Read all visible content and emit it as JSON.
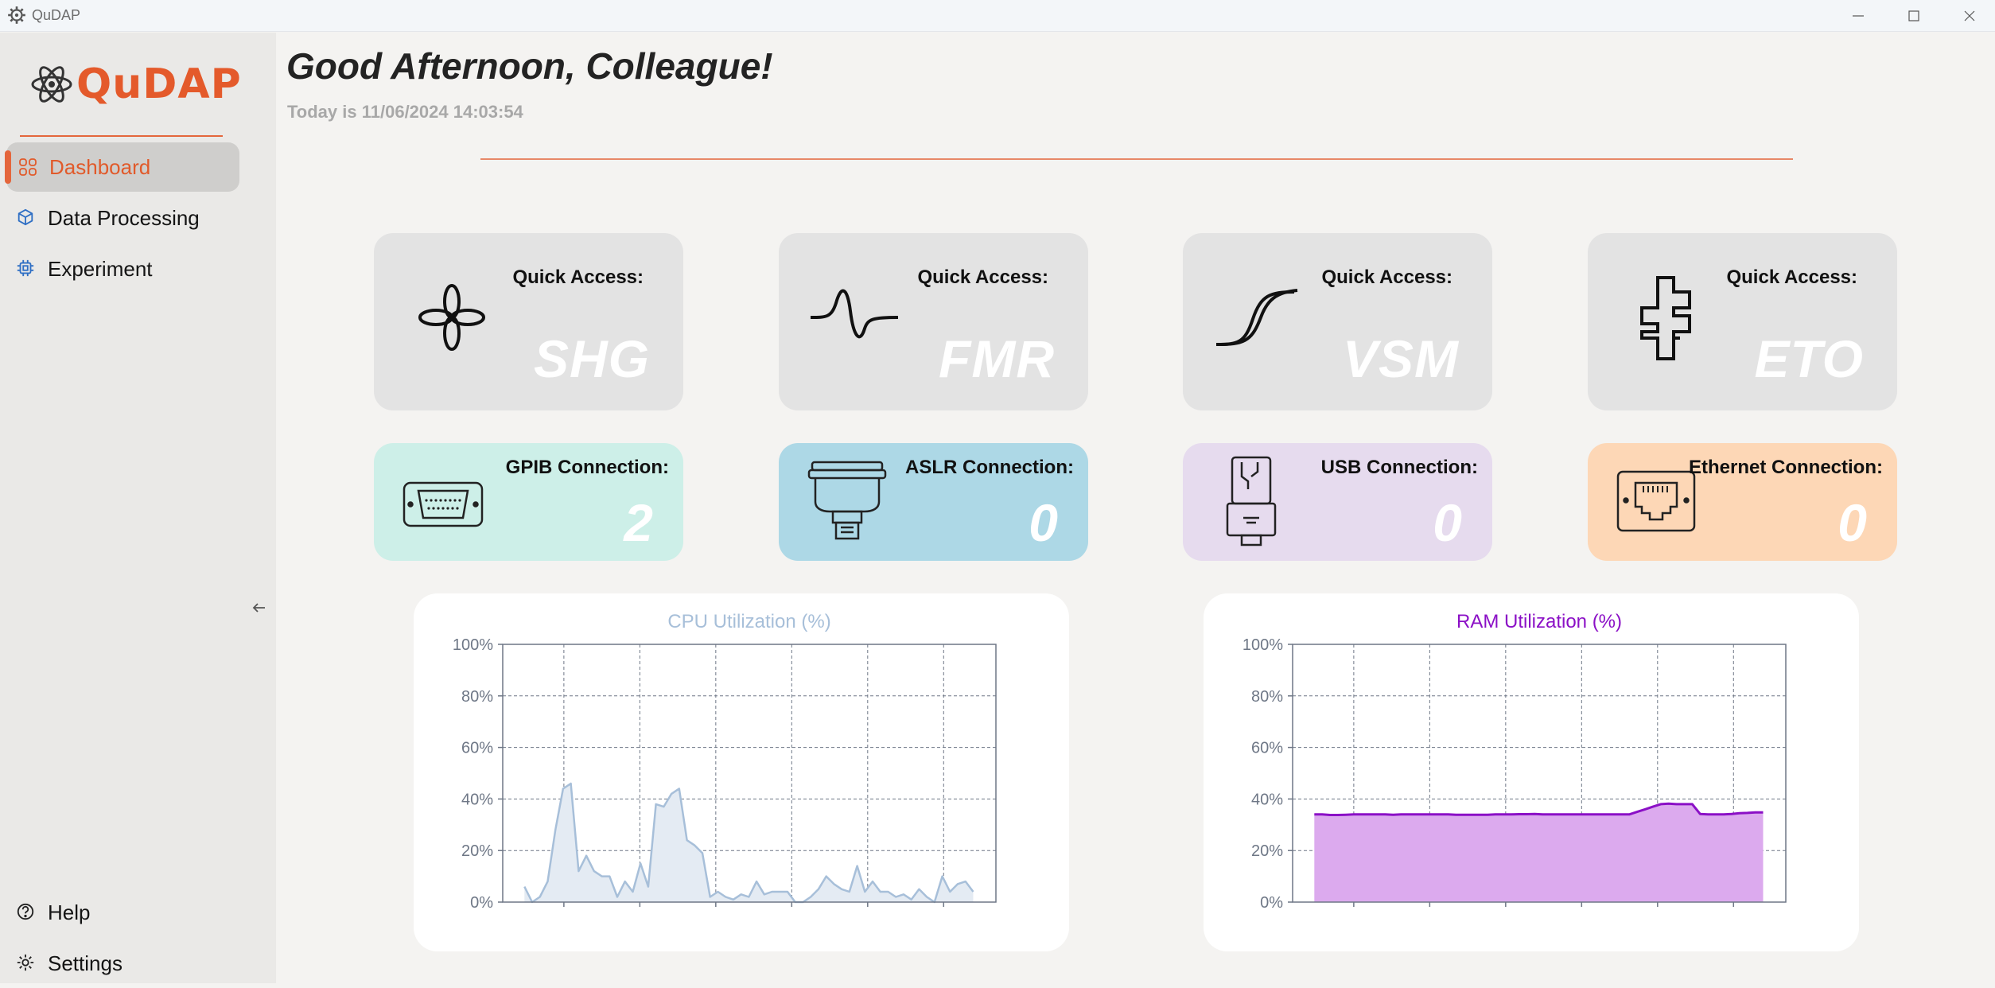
{
  "window": {
    "title": "QuDAP"
  },
  "sidebar": {
    "logo_text": "QuDAP",
    "items": [
      {
        "label": "Dashboard",
        "icon": "grid-icon",
        "active": true
      },
      {
        "label": "Data Processing",
        "icon": "cube-icon",
        "active": false
      },
      {
        "label": "Experiment",
        "icon": "chip-icon",
        "active": false
      }
    ],
    "bottom_items": [
      {
        "label": "Help",
        "icon": "help-icon"
      },
      {
        "label": "Settings",
        "icon": "gear-icon"
      }
    ]
  },
  "header": {
    "greeting": "Good Afternoon, Colleague!",
    "date": "Today is 11/06/2024 14:03:54"
  },
  "quick_access": [
    {
      "label": "Quick Access:",
      "value": "SHG",
      "icon": "flower-icon"
    },
    {
      "label": "Quick Access:",
      "value": "FMR",
      "icon": "resonance-icon"
    },
    {
      "label": "Quick Access:",
      "value": "VSM",
      "icon": "hysteresis-icon"
    },
    {
      "label": "Quick Access:",
      "value": "ETO",
      "icon": "hall-bar-icon"
    }
  ],
  "connections": [
    {
      "label": "GPIB Connection:",
      "value": "2",
      "icon": "gpib-port-icon",
      "color": "#cdefe8"
    },
    {
      "label": "ASLR Connection:",
      "value": "0",
      "icon": "serial-port-icon",
      "color": "#add8e6"
    },
    {
      "label": "USB Connection:",
      "value": "0",
      "icon": "usb-icon",
      "color": "#e6dbee"
    },
    {
      "label": "Ethernet Connection:",
      "value": "0",
      "icon": "ethernet-icon",
      "color": "#fdd7b6"
    }
  ],
  "colors": {
    "accent": "#e45a2b",
    "cpu_line": "#a7bfd9",
    "cpu_fill": "#e4ebf3",
    "ram_line": "#8b10c6",
    "ram_fill": "#dcaaee"
  },
  "chart_data": [
    {
      "type": "area",
      "title": "CPU Utilization (%)",
      "ylim": [
        0,
        100
      ],
      "yticks": [
        "0%",
        "20%",
        "40%",
        "60%",
        "80%",
        "100%"
      ],
      "grid": true,
      "values": [
        6,
        0,
        2,
        8,
        28,
        44,
        46,
        12,
        18,
        12,
        10,
        10,
        2,
        8,
        4,
        15,
        6,
        38,
        37,
        42,
        44,
        24,
        22,
        19,
        2,
        4,
        2,
        1,
        3,
        2,
        8,
        3,
        4,
        4,
        4,
        0,
        0,
        2,
        5,
        10,
        7,
        5,
        4,
        14,
        4,
        8,
        4,
        4,
        2,
        3,
        1,
        5,
        2,
        0,
        10,
        4,
        7,
        8,
        4
      ]
    },
    {
      "type": "area",
      "title": "RAM Utilization (%)",
      "ylim": [
        0,
        100
      ],
      "yticks": [
        "0%",
        "20%",
        "40%",
        "60%",
        "80%",
        "100%"
      ],
      "grid": true,
      "values": [
        34,
        34,
        33.8,
        33.8,
        33.9,
        34,
        34,
        34,
        34,
        34,
        33.9,
        34,
        34,
        34,
        34,
        34,
        34,
        34,
        33.9,
        33.9,
        33.9,
        33.9,
        33.9,
        34,
        34,
        34,
        34.1,
        34.1,
        34.2,
        34,
        34,
        34,
        34,
        34,
        34,
        34,
        34,
        34,
        34,
        34,
        34,
        35,
        36,
        37,
        38,
        38.2,
        38,
        38,
        38,
        34.2,
        34,
        34,
        34,
        34.2,
        34.5,
        34.6,
        34.8,
        34.8
      ]
    }
  ]
}
